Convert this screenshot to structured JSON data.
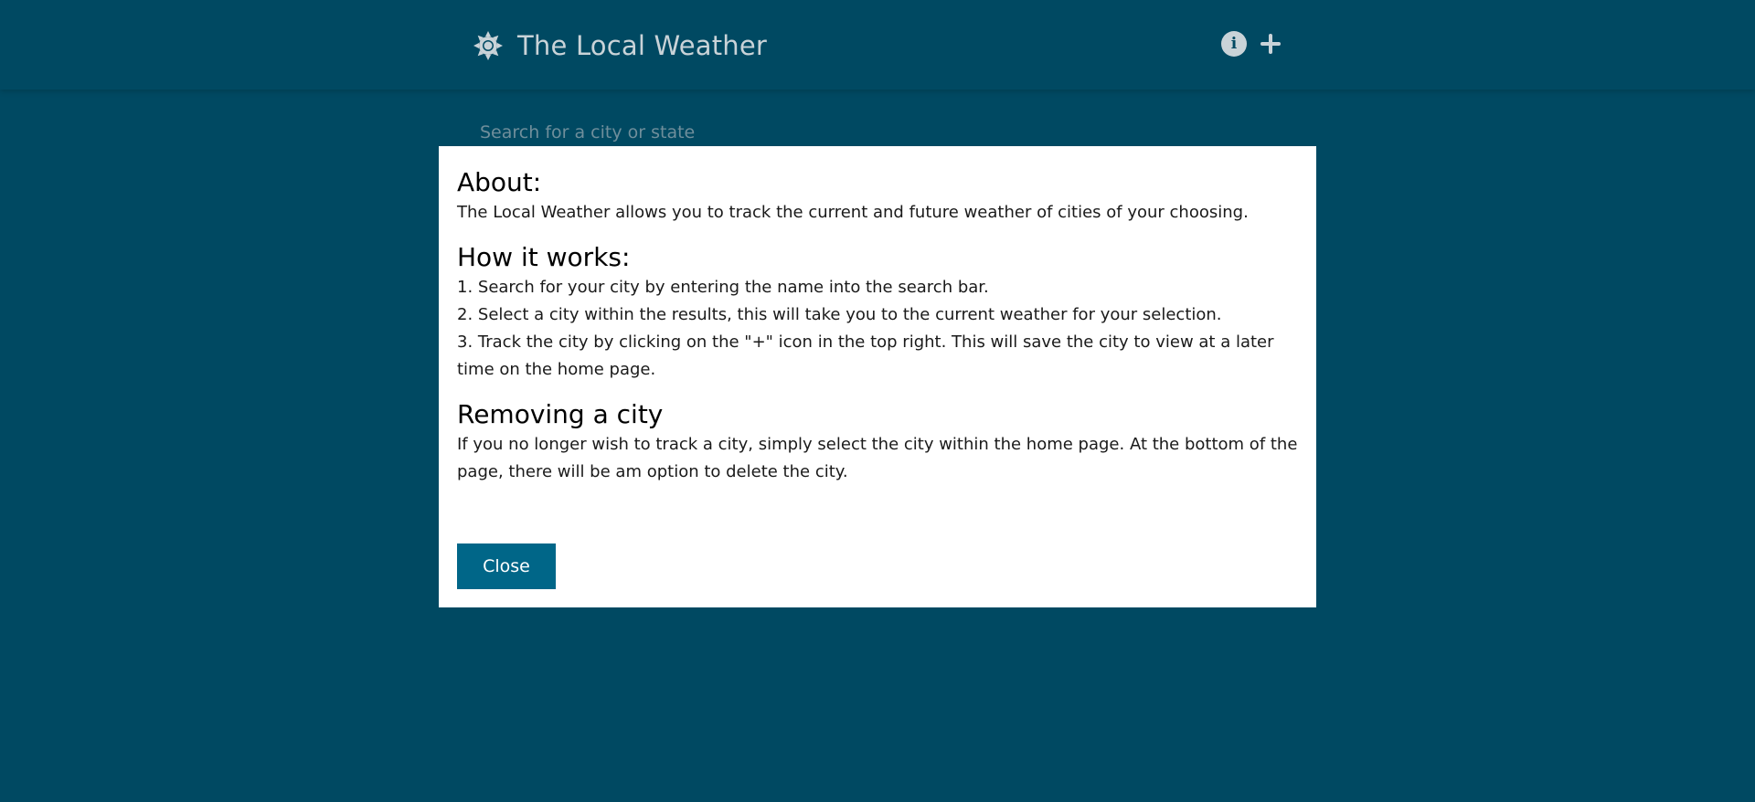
{
  "header": {
    "title": "The Local Weather",
    "icons": {
      "logo": "sun-icon",
      "info": "info-icon",
      "add": "plus-icon"
    },
    "info_glyph": "i"
  },
  "search": {
    "placeholder": "Search for a city or state",
    "value": ""
  },
  "modal": {
    "sections": [
      {
        "heading": "About:",
        "lines": [
          "The Local Weather allows you to track the current and future weather of cities of your choosing."
        ]
      },
      {
        "heading": "How it works:",
        "lines": [
          "1. Search for your city by entering the name into the search bar.",
          "2. Select a city within the results, this will take you to the current weather for your selection.",
          "3. Track the city by clicking on the \"+\" icon in the top right. This will save the city to view at a later time on the home page."
        ]
      },
      {
        "heading": "Removing a city",
        "lines": [
          "If you no longer wish to track a city, simply select the city within the home page. At the bottom of the page, there will be am option to delete the city."
        ]
      }
    ],
    "close_label": "Close"
  },
  "colors": {
    "background": "#004962",
    "header_text": "#c9d3d8",
    "modal_background": "#ffffff",
    "button_background": "#006688"
  }
}
